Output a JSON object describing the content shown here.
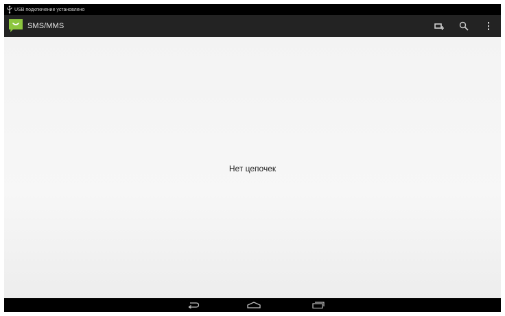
{
  "status_bar": {
    "notification_text": "USB подключение установлено",
    "notification_icon": "usb-icon"
  },
  "action_bar": {
    "app_icon": "sms-app-icon",
    "title": "SMS/MMS",
    "actions": [
      {
        "icon": "compose-icon"
      },
      {
        "icon": "search-icon"
      },
      {
        "icon": "overflow-menu-icon"
      }
    ]
  },
  "content": {
    "empty_message": "Нет цепочек"
  },
  "nav_bar": {
    "buttons": [
      {
        "icon": "back-icon"
      },
      {
        "icon": "home-icon"
      },
      {
        "icon": "recent-apps-icon"
      }
    ]
  },
  "colors": {
    "status_bar_bg": "#000000",
    "action_bar_bg": "#232323",
    "app_icon_green": "#8cc63f",
    "content_bg": "#f4f4f4",
    "nav_bar_bg": "#000000"
  }
}
